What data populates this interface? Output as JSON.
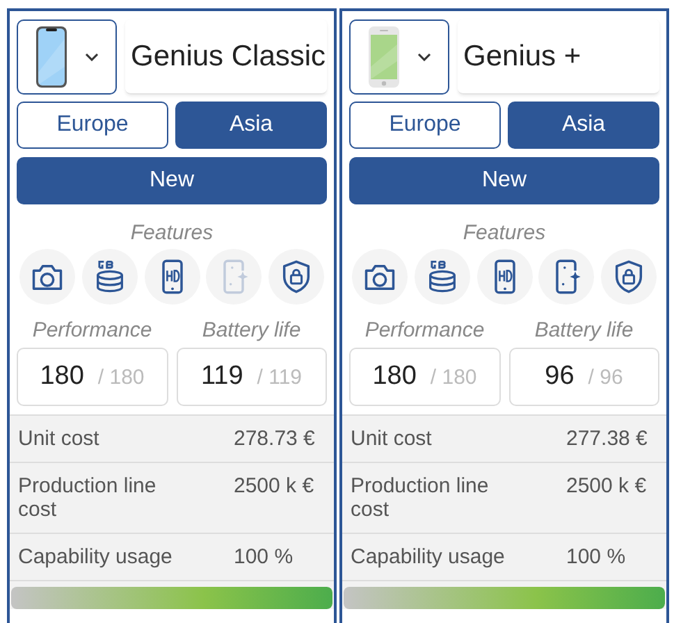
{
  "products": [
    {
      "phone": {
        "kind": "notch",
        "color": "#9fd2f7"
      },
      "name": "Genius Classic",
      "regions": [
        {
          "label": "Europe",
          "selected": false
        },
        {
          "label": "Asia",
          "selected": true
        }
      ],
      "new_button": "New",
      "features_label": "Features",
      "features": [
        {
          "kind": "camera",
          "enabled": true
        },
        {
          "kind": "storage",
          "enabled": true
        },
        {
          "kind": "hd",
          "enabled": true
        },
        {
          "kind": "display",
          "enabled": false
        },
        {
          "kind": "security",
          "enabled": true
        }
      ],
      "stats": [
        {
          "label": "Performance",
          "value": "180",
          "max": "/ 180"
        },
        {
          "label": "Battery life",
          "value": "119",
          "max": "/ 119"
        }
      ],
      "costs": [
        {
          "label": "Unit cost",
          "value": "278.73 €"
        },
        {
          "label": "Production line cost",
          "value": "2500 k €"
        },
        {
          "label": "Capability usage",
          "value": "100 %"
        }
      ],
      "capability": {
        "level": 1
      }
    },
    {
      "phone": {
        "kind": "home-button",
        "color": "#a9d68a"
      },
      "name": "Genius +",
      "regions": [
        {
          "label": "Europe",
          "selected": false
        },
        {
          "label": "Asia",
          "selected": true
        }
      ],
      "new_button": "New",
      "features_label": "Features",
      "features": [
        {
          "kind": "camera",
          "enabled": true
        },
        {
          "kind": "storage",
          "enabled": true
        },
        {
          "kind": "hd",
          "enabled": true
        },
        {
          "kind": "display",
          "enabled": true
        },
        {
          "kind": "security",
          "enabled": true
        }
      ],
      "stats": [
        {
          "label": "Performance",
          "value": "180",
          "max": "/ 180"
        },
        {
          "label": "Battery life",
          "value": "96",
          "max": "/ 96"
        }
      ],
      "costs": [
        {
          "label": "Unit cost",
          "value": "277.38 €"
        },
        {
          "label": "Production line cost",
          "value": "2500 k €"
        },
        {
          "label": "Capability usage",
          "value": "100 %"
        }
      ],
      "capability": {
        "level": 1
      }
    }
  ]
}
